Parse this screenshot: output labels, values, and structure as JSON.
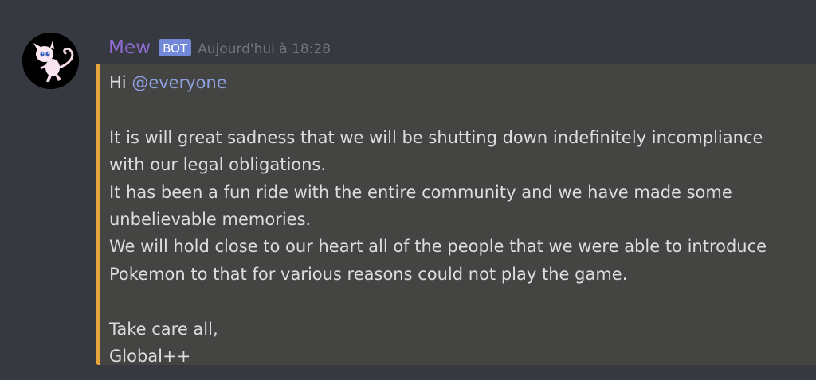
{
  "message": {
    "author": "Mew",
    "bot_tag": "BOT",
    "timestamp": "Aujourd'hui à 18:28",
    "embed_color": "#e7a63b",
    "greeting": "Hi ",
    "mention": "@everyone",
    "lines": [
      "",
      "It is will great sadness that we will be shutting down indefinitely incompliance",
      "with our legal obligations.",
      "It has been a fun ride with the entire community and we have made some",
      "unbelievable memories.",
      "We will hold close to our heart all of the people that we were able to introduce",
      "Pokemon to that for various reasons could not play the game.",
      "",
      "Take care all,",
      "Global++"
    ]
  },
  "colors": {
    "background": "#36393f",
    "username": "#8e6bd0",
    "bot_tag": "#7289da",
    "mention": "#8ea1e1",
    "text": "#dcddde",
    "embed_background": "#444443"
  }
}
